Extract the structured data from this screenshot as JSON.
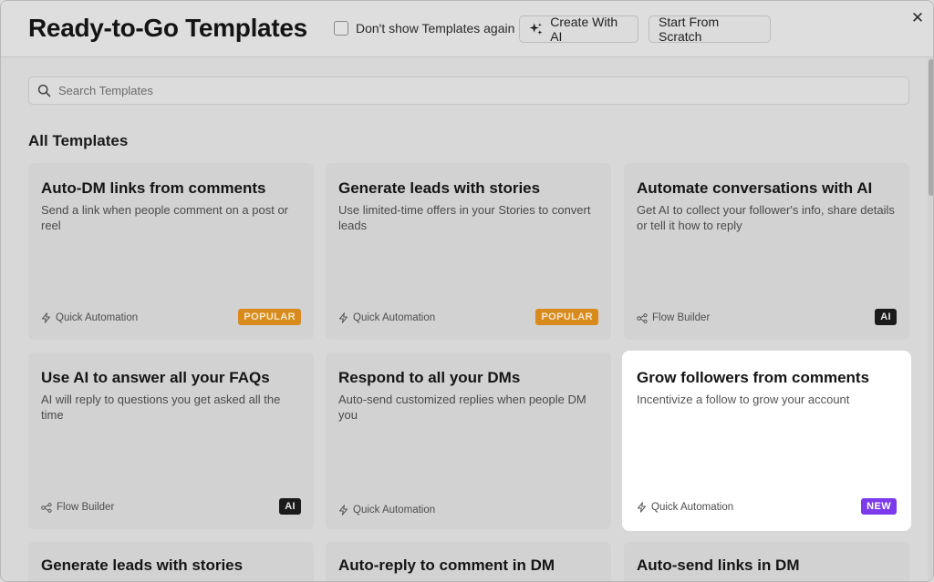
{
  "header": {
    "title": "Ready-to-Go Templates",
    "dont_show_label": "Don't show Templates again",
    "create_ai_label": "Create With AI",
    "start_scratch_label": "Start From Scratch",
    "close_glyph": "✕"
  },
  "search": {
    "placeholder": "Search Templates"
  },
  "section_title": "All Templates",
  "colors": {
    "popular": "#d98a1c",
    "ai": "#1b1b1b",
    "new": "#7d3aed"
  },
  "cards": [
    {
      "title": "Auto-DM links from comments",
      "desc": "Send a link when people comment on a post or reel",
      "type": "Quick Automation",
      "type_icon": "bolt-icon",
      "badge": "POPULAR"
    },
    {
      "title": "Generate leads with stories",
      "desc": "Use limited-time offers in your Stories to convert leads",
      "type": "Quick Automation",
      "type_icon": "bolt-icon",
      "badge": "POPULAR"
    },
    {
      "title": "Automate conversations with AI",
      "desc": "Get AI to collect your follower's info, share details or tell it how to reply",
      "type": "Flow Builder",
      "type_icon": "flow-icon",
      "badge": "AI"
    },
    {
      "title": "Use AI to answer all your FAQs",
      "desc": "AI will reply to questions you get asked all the time",
      "type": "Flow Builder",
      "type_icon": "flow-icon",
      "badge": "AI"
    },
    {
      "title": "Respond to all your DMs",
      "desc": "Auto-send customized replies when people DM you",
      "type": "Quick Automation",
      "type_icon": "bolt-icon",
      "badge": ""
    },
    {
      "title": "Grow followers from comments",
      "desc": "Incentivize a follow to grow your account",
      "type": "Quick Automation",
      "type_icon": "bolt-icon",
      "badge": "NEW"
    },
    {
      "title": "Generate leads with stories"
    },
    {
      "title": "Auto-reply to comment in DM"
    },
    {
      "title": "Auto-send links in DM"
    }
  ]
}
